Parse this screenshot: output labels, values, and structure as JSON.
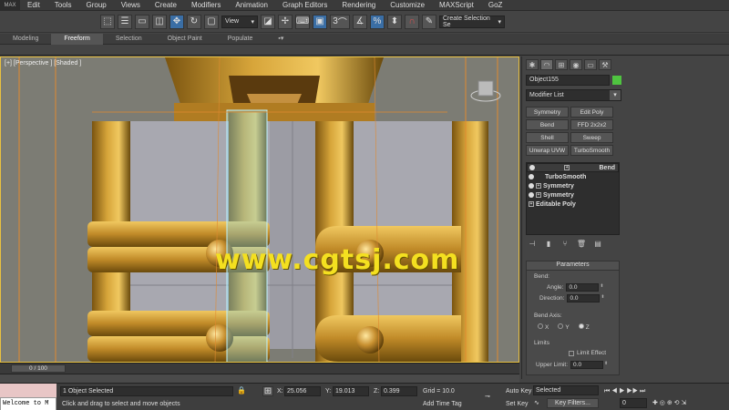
{
  "menu": {
    "logo": "MAX",
    "items": [
      "Edit",
      "Tools",
      "Group",
      "Views",
      "Create",
      "Modifiers",
      "Animation",
      "Graph Editors",
      "Rendering",
      "Customize",
      "MAXScript",
      "GoZ"
    ]
  },
  "toolbar": {
    "view_select": "View",
    "selection_set": "Create Selection Se",
    "snap_value": "3"
  },
  "ribbon": {
    "tabs": [
      "Modeling",
      "Freeform",
      "Selection",
      "Object Paint",
      "Populate"
    ],
    "active": "Freeform"
  },
  "viewport": {
    "label": "[+] [Perspective ] [Shaded ]",
    "watermark": "www.cgtsj.com"
  },
  "command_panel": {
    "object_name": "Object155",
    "object_color": "#4fc440",
    "modifier_list": "Modifier List",
    "modifier_buttons": [
      "Symmetry",
      "Edit Poly",
      "Bend",
      "FFD 2x2x2",
      "Shell",
      "Sweep",
      "Unwrap UVW",
      "TurboSmooth"
    ],
    "stack": [
      {
        "name": "Bend",
        "has_plus": true
      },
      {
        "name": "TurboSmooth",
        "has_plus": false
      },
      {
        "name": "Symmetry",
        "has_plus": true
      },
      {
        "name": "Symmetry",
        "has_plus": true
      },
      {
        "name": "Editable Poly",
        "has_plus": true
      }
    ],
    "params": {
      "title": "Parameters",
      "bend_label": "Bend:",
      "angle_label": "Angle:",
      "angle_value": "0.0",
      "direction_label": "Direction:",
      "direction_value": "0.0",
      "axis_label": "Bend Axis:",
      "axes": [
        "X",
        "Y",
        "Z"
      ],
      "selected_axis": "Z",
      "limits_label": "Limits",
      "limit_effect": "Limit Effect",
      "upper_limit_label": "Upper Limit:",
      "upper_limit_value": "0.0"
    }
  },
  "timeline": {
    "slider": "0 / 100"
  },
  "status": {
    "maxscript_text": "Welcome to M",
    "selected": "1 Object Selected",
    "prompt": "Click and drag to select and move objects",
    "x_label": "X:",
    "x_value": "25.056",
    "y_label": "Y:",
    "y_value": "19.013",
    "z_label": "Z:",
    "z_value": "0.399",
    "grid": "Grid = 10.0",
    "add_time_tag": "Add Time Tag",
    "auto_key": "Auto Key",
    "key_mode": "Selected",
    "set_key": "Set Key",
    "key_filters": "Key Filters...",
    "frame": "0"
  }
}
